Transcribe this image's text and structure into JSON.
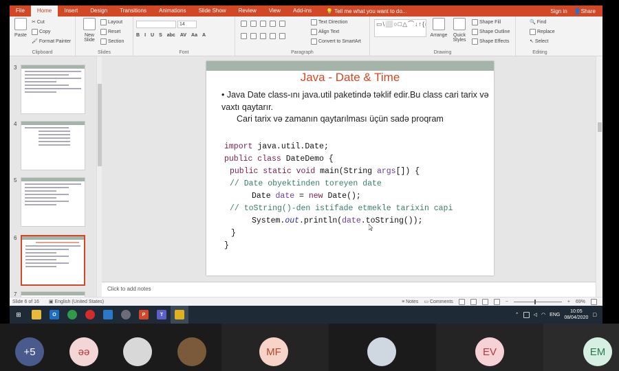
{
  "menubar": {
    "tabs": [
      "File",
      "Home",
      "Insert",
      "Design",
      "Transitions",
      "Animations",
      "Slide Show",
      "Review",
      "View",
      "Add-ins"
    ],
    "active_tab": "Home",
    "tell_me": "Tell me what you want to do...",
    "sign_in": "Sign in",
    "share": "Share"
  },
  "ribbon": {
    "clipboard": {
      "label": "Clipboard",
      "paste": "Paste",
      "cut": "Cut",
      "copy": "Copy",
      "format_painter": "Format Painter"
    },
    "slides": {
      "label": "Slides",
      "new_slide": "New Slide",
      "layout": "Layout",
      "reset": "Reset",
      "section": "Section"
    },
    "font": {
      "label": "Font",
      "font_name": "",
      "font_size": "14",
      "buttons": [
        "B",
        "I",
        "U",
        "S",
        "abc",
        "AV",
        "Aa",
        "A"
      ]
    },
    "paragraph": {
      "label": "Paragraph",
      "text_direction": "Text Direction",
      "align_text": "Align Text",
      "convert_smartart": "Convert to SmartArt"
    },
    "drawing": {
      "label": "Drawing",
      "shapes_preview": "▭\\⬜○□△⌒↓↑{(☆",
      "arrange": "Arrange",
      "quick_styles": "Quick Styles",
      "shape_fill": "Shape Fill",
      "shape_outline": "Shape Outline",
      "shape_effects": "Shape Effects"
    },
    "editing": {
      "label": "Editing",
      "find": "Find",
      "replace": "Replace",
      "select": "Select"
    }
  },
  "thumbnails": [
    {
      "number": "3"
    },
    {
      "number": "4"
    },
    {
      "number": "5"
    },
    {
      "number": "6",
      "selected": true
    },
    {
      "number": "7"
    }
  ],
  "slide": {
    "title": "Java - Date & Time",
    "bullet": "Java Date class-ını java.util paketində təklif edir.Bu class cari tarix və vaxtı qaytarır.",
    "sub": "Cari tarix və zamanın qaytarılması üçün sadə proqram",
    "code": {
      "l1_kw": "import",
      "l1_rest": " java.util.Date;",
      "l2_kw": "public class",
      "l2_rest": " DateDemo {",
      "l3_kw": "public static void",
      "l3_rest": " main(String ",
      "l3_var": "args",
      "l3_end": "[]) {",
      "l4": "// Date obyektinden toreyen date",
      "l5_a": "Date ",
      "l5_var": "date",
      "l5_b": " = ",
      "l5_kw": "new",
      "l5_c": " Date();",
      "l6": "// toString()-den istifade etmekle tarixin capi",
      "l7_a": "System.",
      "l7_it": "out",
      "l7_b": ".println(",
      "l7_var": "date",
      "l7_c": ".toString());",
      "l8": "}",
      "l9": "}"
    }
  },
  "notes_placeholder": "Click to add notes",
  "status": {
    "slide_info": "Slide 6 of 16",
    "language": "English (United States)",
    "notes": "Notes",
    "comments": "Comments",
    "zoom": "69%"
  },
  "taskbar": {
    "lang": "ENG",
    "time": "10:05",
    "date": "08/04/2020"
  },
  "participants": [
    {
      "label": "+5",
      "bg": "#4a5a8c",
      "fg": "#ffffff"
    },
    {
      "label": "əə",
      "bg": "#f4d6d6",
      "fg": "#b23a3a"
    },
    {
      "label": "",
      "bg": "#d8d8d8",
      "fg": "#333333",
      "photo": true
    },
    {
      "label": "",
      "bg": "#7a5a3a",
      "fg": "#ffffff",
      "photo": true
    },
    {
      "label": "MF",
      "bg": "#f7d3c8",
      "fg": "#b2482c"
    },
    {
      "label": "",
      "bg": "#cfd8e0",
      "fg": "#333333",
      "photo": true
    },
    {
      "label": "EV",
      "bg": "#f6d2d6",
      "fg": "#b23a48"
    },
    {
      "label": "EM",
      "bg": "#d6efe2",
      "fg": "#2a7a4a"
    }
  ]
}
